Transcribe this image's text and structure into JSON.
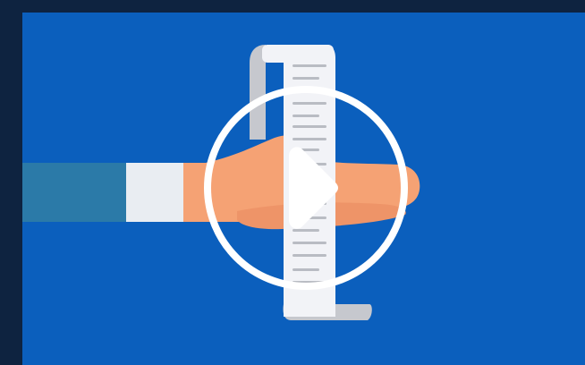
{
  "colors": {
    "frame": "#0e2340",
    "background": "#0b5fbd",
    "sleeve": "#2b7aa8",
    "cuff": "#e9edf2",
    "hand": "#f5a274",
    "hand_shadow": "#ee9468",
    "receipt": "#f2f3f7",
    "receipt_curl": "#c6c8ce",
    "receipt_lines": "#b9bcc3",
    "play_button": "#ffffff"
  },
  "icons": {
    "play": "play-icon",
    "receipt": "receipt-icon",
    "hand": "hand-icon"
  },
  "video": {
    "state": "paused"
  }
}
